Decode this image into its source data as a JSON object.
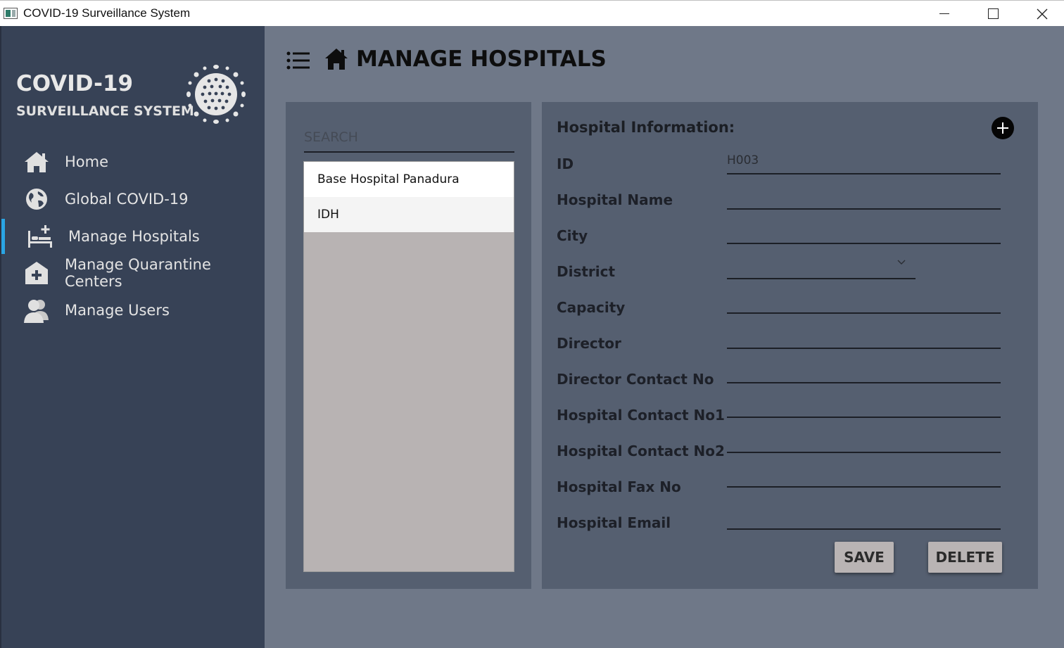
{
  "window": {
    "title": "COVID-19 Surveillance System"
  },
  "sidebar": {
    "brand_title": "COVID-19",
    "brand_subtitle": "SURVEILLANCE SYSTEM",
    "items": [
      {
        "label": "Home",
        "icon": "home-icon"
      },
      {
        "label": "Global COVID-19",
        "icon": "globe-icon"
      },
      {
        "label": "Manage Hospitals",
        "icon": "hospital-bed-icon",
        "active": true
      },
      {
        "label": "Manage Quarantine Centers",
        "icon": "medical-house-icon"
      },
      {
        "label": "Manage Users",
        "icon": "users-icon"
      }
    ]
  },
  "header": {
    "title": "MANAGE HOSPITALS"
  },
  "search": {
    "placeholder": "SEARCH"
  },
  "hospital_list": [
    "Base Hospital Panadura",
    "IDH"
  ],
  "form": {
    "heading": "Hospital Information:",
    "fields": [
      {
        "label": "ID",
        "value": "H003"
      },
      {
        "label": "Hospital Name",
        "value": ""
      },
      {
        "label": "City",
        "value": ""
      },
      {
        "label": "District",
        "value": ""
      },
      {
        "label": "Capacity",
        "value": ""
      },
      {
        "label": "Director",
        "value": ""
      },
      {
        "label": "Director Contact No",
        "value": ""
      },
      {
        "label": "Hospital Contact No1",
        "value": ""
      },
      {
        "label": "Hospital Contact No2",
        "value": ""
      },
      {
        "label": "Hospital Fax No",
        "value": ""
      },
      {
        "label": "Hospital Email",
        "value": ""
      }
    ],
    "save_label": "SAVE",
    "delete_label": "DELETE"
  },
  "colors": {
    "sidebar_bg": "#374256",
    "main_bg": "#6f7888",
    "panel_bg": "#555f70",
    "active_indicator": "#2aa5e4"
  }
}
